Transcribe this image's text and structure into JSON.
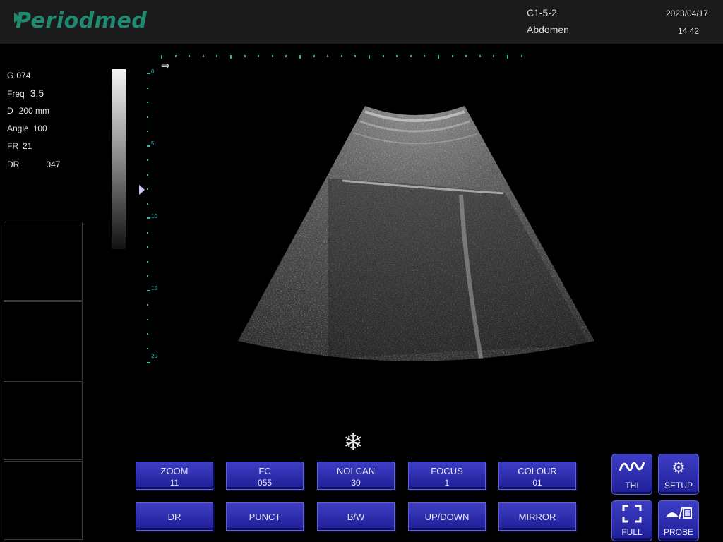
{
  "header": {
    "logo": "Periodmed",
    "probe": "C1-5-2",
    "exam": "Abdomen",
    "date": "2023/04/17",
    "time": "14  42"
  },
  "params": [
    {
      "label": "G",
      "value": "074"
    },
    {
      "label": "Freq",
      "value": "3.5"
    },
    {
      "label": "D",
      "value": "200 mm"
    },
    {
      "label": "Angle",
      "value": "100"
    },
    {
      "label": "FR",
      "value": "21"
    },
    {
      "label": "DR",
      "value": "047"
    }
  ],
  "depth_scale": {
    "labels": [
      "0",
      "5",
      "10",
      "15",
      "20"
    ]
  },
  "icons": {
    "freeze": "snowflake-icon",
    "direction": "arrow-right-icon",
    "focus": "focus-marker-icon",
    "thi": "wave-icon",
    "setup": "gear-icon",
    "full": "fullscreen-icon",
    "probe": "probe-icon"
  },
  "buttons": {
    "zoom": {
      "label": "ZOOM",
      "value": "11"
    },
    "fc": {
      "label": "FC",
      "value": "055"
    },
    "noican": {
      "label": "NOI CAN",
      "value": "30"
    },
    "focus": {
      "label": "FOCUS",
      "value": "1"
    },
    "colour": {
      "label": "COLOUR",
      "value": "01"
    },
    "dr": {
      "label": "DR"
    },
    "punct": {
      "label": "PUNCT"
    },
    "bw": {
      "label": "B/W"
    },
    "updown": {
      "label": "UP/DOWN"
    },
    "mirror": {
      "label": "MIRROR"
    }
  },
  "side_buttons": {
    "thi": {
      "label": "THI"
    },
    "setup": {
      "label": "SETUP"
    },
    "full": {
      "label": "FULL"
    },
    "probe": {
      "label": "PROBE"
    }
  },
  "colors": {
    "accent": "#1f8a70",
    "button": "#2b2bb0",
    "scale": "#2fb5a6"
  }
}
